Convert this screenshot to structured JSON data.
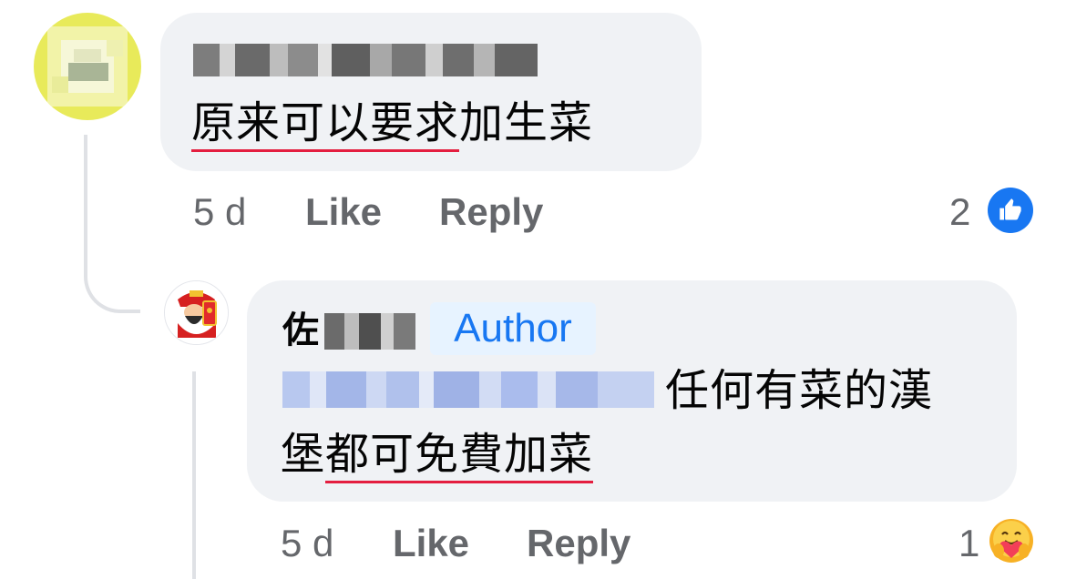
{
  "comment1": {
    "text_underlined": "原来可以要求",
    "text_rest": "加生菜",
    "time": "5 d",
    "like_label": "Like",
    "reply_label": "Reply",
    "reaction_count": "2",
    "reaction_icon": "like-icon"
  },
  "comment2": {
    "author_first_char": "佐",
    "author_badge": "Author",
    "line1_text": "任何有菜的漢",
    "line2_plain": "堡",
    "line2_underlined": "都可免費加菜",
    "time": "5 d",
    "like_label": "Like",
    "reply_label": "Reply",
    "reaction_count": "1",
    "reaction_icon": "care-icon"
  },
  "colors": {
    "bubble": "#f0f2f5",
    "meta_text": "#65676b",
    "author_badge_bg": "#e7f3ff",
    "author_badge_text": "#1877f2",
    "spell_underline": "#e41e3f",
    "like_blue": "#1877f2"
  }
}
